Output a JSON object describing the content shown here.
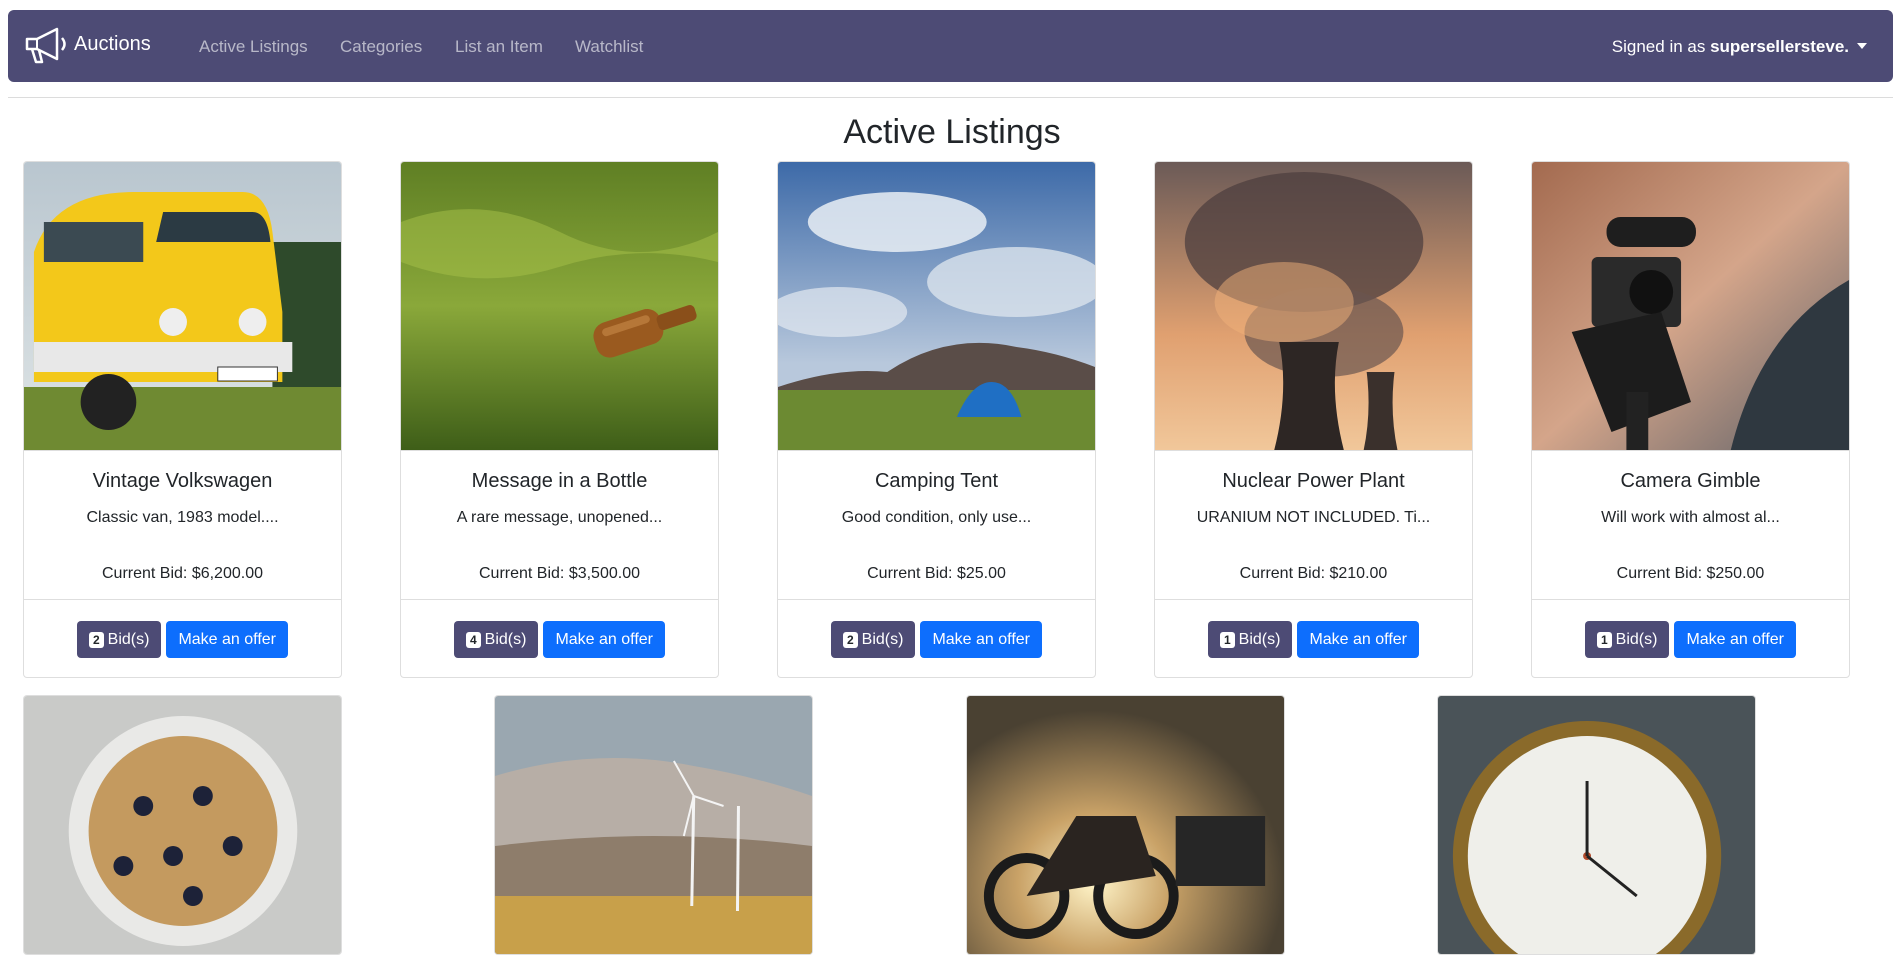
{
  "navbar": {
    "brand": "Auctions",
    "links": [
      "Active Listings",
      "Categories",
      "List an Item",
      "Watchlist"
    ],
    "user_prefix": "Signed in as ",
    "username": "supersellersteve."
  },
  "page": {
    "title": "Active Listings"
  },
  "listings": [
    {
      "title": "Vintage Volkswagen",
      "desc": "Classic van, 1983 model....",
      "bid": "Current Bid: $6,200.00",
      "bid_count": "2",
      "bids_label": "Bid(s)",
      "offer_label": "Make an offer"
    },
    {
      "title": "Message in a Bottle",
      "desc": "A rare message, unopened...",
      "bid": "Current Bid: $3,500.00",
      "bid_count": "4",
      "bids_label": "Bid(s)",
      "offer_label": "Make an offer"
    },
    {
      "title": "Camping Tent",
      "desc": "Good condition, only use...",
      "bid": "Current Bid: $25.00",
      "bid_count": "2",
      "bids_label": "Bid(s)",
      "offer_label": "Make an offer"
    },
    {
      "title": "Nuclear Power Plant",
      "desc": "URANIUM NOT INCLUDED. Ti...",
      "bid": "Current Bid: $210.00",
      "bid_count": "1",
      "bids_label": "Bid(s)",
      "offer_label": "Make an offer"
    },
    {
      "title": "Camera Gimble",
      "desc": "Will work with almost al...",
      "bid": "Current Bid: $250.00",
      "bid_count": "1",
      "bids_label": "Bid(s)",
      "offer_label": "Make an offer"
    }
  ],
  "colors": {
    "navbar": "#4d4b75",
    "primary": "#0d6efd"
  }
}
